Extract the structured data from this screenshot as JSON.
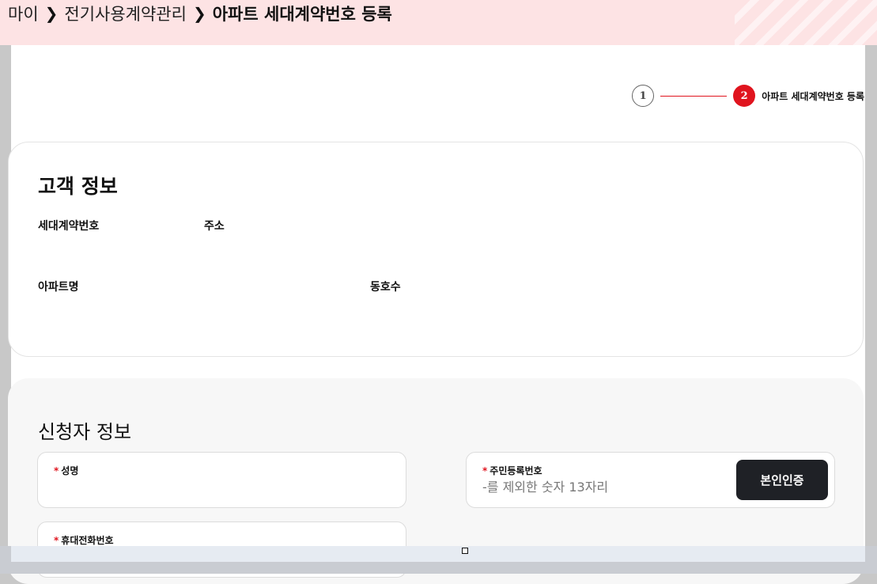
{
  "breadcrumb": {
    "items": [
      "마이",
      "전기사용계약관리"
    ],
    "current": "아파트 세대계약번호 등록"
  },
  "stepper": {
    "step1": "1",
    "step2": "2",
    "active_label": "아파트 세대계약번호 등록"
  },
  "customer_info": {
    "title": "고객 정보",
    "household_contract_no_label": "세대계약번호",
    "address_label": "주소",
    "apartment_name_label": "아파트명",
    "unit_label": "동호수"
  },
  "applicant_info": {
    "title": "신청자 정보",
    "name_field": {
      "required_mark": "*",
      "label": "성명",
      "value": ""
    },
    "rrn_field": {
      "required_mark": "*",
      "label": "주민등록번호",
      "placeholder": "-를 제외한 숫자 13자리",
      "value": ""
    },
    "verify_button": "본인인증",
    "phone_field": {
      "required_mark": "*",
      "label": "휴대전화번호"
    }
  },
  "colors": {
    "accent": "#e0141e",
    "breadcrumb_bg": "#fde3e4",
    "button_dark": "#1f2126",
    "panel_bg": "#f7f7f7"
  }
}
